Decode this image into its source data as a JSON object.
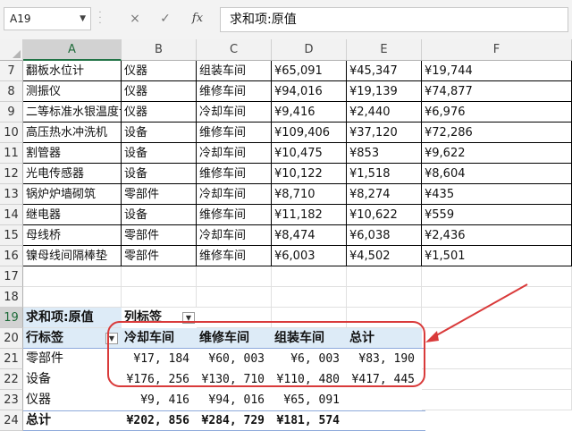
{
  "namebox": "A19",
  "formula": "求和项:原值",
  "icons": {
    "cancel": "×",
    "enter": "✓",
    "fx": "fx"
  },
  "columns": [
    "A",
    "B",
    "C",
    "D",
    "E",
    "F"
  ],
  "rows": [
    {
      "n": "7",
      "a": "翻板水位计",
      "b": "仪器",
      "c": "组装车间",
      "d": "¥65,091",
      "e": "¥45,347",
      "f": "¥19,744"
    },
    {
      "n": "8",
      "a": "测振仪",
      "b": "仪器",
      "c": "维修车间",
      "d": "¥94,016",
      "e": "¥19,139",
      "f": "¥74,877"
    },
    {
      "n": "9",
      "a": "二等标准水银温度计",
      "b": "仪器",
      "c": "冷却车间",
      "d": "¥9,416",
      "e": "¥2,440",
      "f": "¥6,976"
    },
    {
      "n": "10",
      "a": "高压热水冲洗机",
      "b": "设备",
      "c": "维修车间",
      "d": "¥109,406",
      "e": "¥37,120",
      "f": "¥72,286"
    },
    {
      "n": "11",
      "a": "割管器",
      "b": "设备",
      "c": "冷却车间",
      "d": "¥10,475",
      "e": "¥853",
      "f": "¥9,622"
    },
    {
      "n": "12",
      "a": "光电传感器",
      "b": "设备",
      "c": "维修车间",
      "d": "¥10,122",
      "e": "¥1,518",
      "f": "¥8,604"
    },
    {
      "n": "13",
      "a": "锅炉炉墙砌筑",
      "b": "零部件",
      "c": "冷却车间",
      "d": "¥8,710",
      "e": "¥8,274",
      "f": "¥435"
    },
    {
      "n": "14",
      "a": "继电器",
      "b": "设备",
      "c": "维修车间",
      "d": "¥11,182",
      "e": "¥10,622",
      "f": "¥559"
    },
    {
      "n": "15",
      "a": "母线桥",
      "b": "零部件",
      "c": "冷却车间",
      "d": "¥8,474",
      "e": "¥6,038",
      "f": "¥2,436"
    },
    {
      "n": "16",
      "a": "镍母线间隔棒垫",
      "b": "零部件",
      "c": "维修车间",
      "d": "¥6,003",
      "e": "¥4,502",
      "f": "¥1,501"
    }
  ],
  "empty_rows": [
    "17",
    "18"
  ],
  "pivot": {
    "r19": {
      "n": "19",
      "a": "求和项:原值",
      "b": "列标签"
    },
    "r20": {
      "n": "20",
      "a": "行标签",
      "b": "冷却车间",
      "c": "维修车间",
      "d": "组装车间",
      "e": "总计"
    },
    "body": [
      {
        "n": "21",
        "a": "零部件",
        "b": "¥17, 184",
        "c": "¥60, 003",
        "d": "¥6, 003",
        "e": "¥83, 190"
      },
      {
        "n": "22",
        "a": "设备",
        "b": "¥176, 256",
        "c": "¥130, 710",
        "d": "¥110, 480",
        "e": "¥417, 445"
      },
      {
        "n": "23",
        "a": "仪器",
        "b": "¥9, 416",
        "c": "¥94, 016",
        "d": "¥65, 091",
        "e": ""
      }
    ],
    "total": {
      "n": "24",
      "a": "总计",
      "b": "¥202, 856",
      "c": "¥284, 729",
      "d": "¥181, 574",
      "e": ""
    }
  },
  "colors": {
    "highlight_oval": "#d93a3a",
    "pivot_band": "#8eaadb",
    "accent": "#217346"
  }
}
